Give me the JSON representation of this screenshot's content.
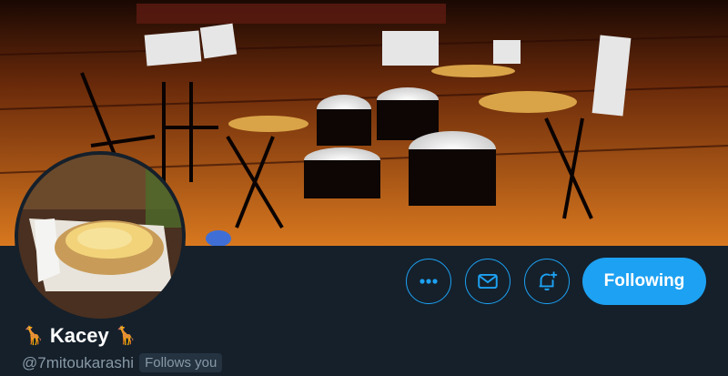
{
  "profile": {
    "display_name": "Kacey",
    "name_emoji_left": "🦒",
    "name_emoji_right": "🦒",
    "handle": "@7mitoukarashi",
    "follows_you_badge": "Follows you"
  },
  "actions": {
    "more_icon": "more-dots-icon",
    "message_icon": "envelope-icon",
    "notify_icon": "bell-plus-icon",
    "following_label": "Following"
  },
  "colors": {
    "background": "#15202b",
    "accent": "#1da1f2",
    "secondary_text": "#8899a6"
  }
}
